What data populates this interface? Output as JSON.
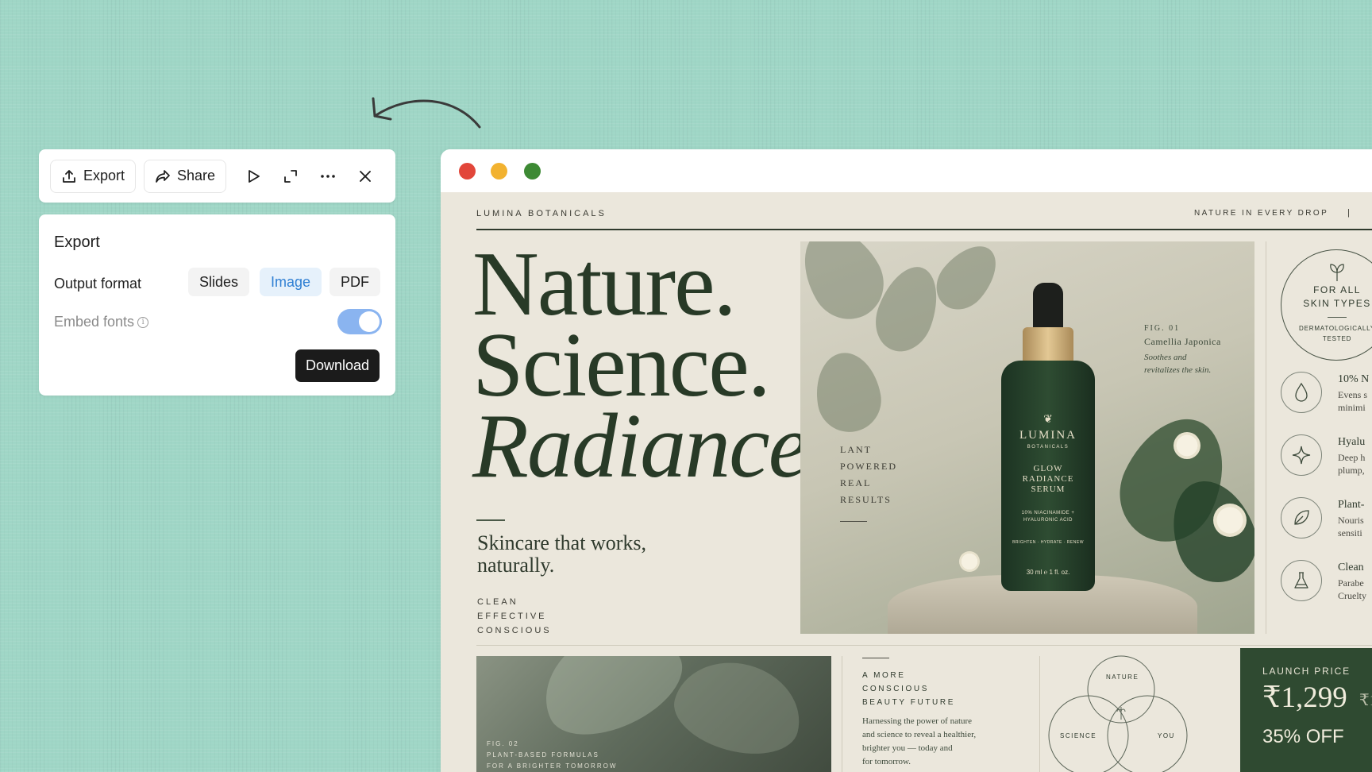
{
  "toolbar": {
    "export_label": "Export",
    "share_label": "Share",
    "icons": [
      "upload-icon",
      "share-icon",
      "play-icon",
      "expand-icon",
      "more-icon",
      "close-icon"
    ]
  },
  "export_panel": {
    "title": "Export",
    "output_format_label": "Output format",
    "formats": [
      "Slides",
      "Image",
      "PDF"
    ],
    "selected_format": "Image",
    "embed_fonts_label": "Embed fonts",
    "embed_fonts_enabled": true,
    "download_label": "Download"
  },
  "colors": {
    "background": "#9fd6c6",
    "accent": "#2f7fd3",
    "traffic_red": "#e2463a",
    "traffic_yellow": "#f2b230",
    "traffic_green": "#3d8a34",
    "poster_green": "#2f4a31"
  },
  "poster": {
    "brand": "LUMINA BOTANICALS",
    "tagline": "NATURE IN EVERY DROP",
    "tagline_separator": "|",
    "headline_1": "Nature.",
    "headline_2": "Science.",
    "headline_3": "Radiance.",
    "subheadline_1": "Skincare that works,",
    "subheadline_2": "naturally.",
    "attributes": [
      "CLEAN",
      "EFFECTIVE",
      "CONSCIOUS"
    ],
    "plant_claim": [
      "LANT",
      "POWERED",
      "REAL",
      "RESULTS"
    ],
    "fig1": {
      "label": "FIG. 01",
      "name": "Camellia Japonica",
      "desc_1": "Soothes and",
      "desc_2": "revitalizes the skin."
    },
    "bottle": {
      "brand": "LUMINA",
      "sub": "BOTANICALS",
      "product": "GLOW RADIANCE SERUM",
      "ingredients": "10% NIACINAMIDE + HYALURONIC ACID",
      "benefits": "BRIGHTEN · HYDRATE · RENEW",
      "volume": "30 ml ℮ 1 fl. oz."
    },
    "badge": {
      "title": "FOR ALL\nSKIN TYPES",
      "sub": "DERMATOLOGICALLY\nTESTED"
    },
    "features": [
      {
        "icon": "drop-icon",
        "title": "10% N",
        "line1": "Evens s",
        "line2": "minimi"
      },
      {
        "icon": "sparkle-icon",
        "title": "Hyalu",
        "line1": "Deep h",
        "line2": "plump,"
      },
      {
        "icon": "leaf-icon",
        "title": "Plant-",
        "line1": "Nouris",
        "line2": "sensiti"
      },
      {
        "icon": "flask-icon",
        "title": "Clean",
        "line1": "Parabe",
        "line2": "Cruelty"
      }
    ],
    "fig2": {
      "label": "FIG. 02",
      "line1": "PLANT-BASED FORMULAS",
      "line2": "FOR A BRIGHTER TOMORROW"
    },
    "future": {
      "heading": [
        "A MORE",
        "CONSCIOUS",
        "BEAUTY FUTURE"
      ],
      "body": [
        "Harnessing the power of nature",
        "and science to reveal a healthier,",
        "brighter you — today and",
        "for tomorrow."
      ]
    },
    "venn": {
      "top": "NATURE",
      "left": "SCIENCE",
      "right": "YOU"
    },
    "price": {
      "label": "LAUNCH PRICE",
      "value": "₹1,299",
      "old": "₹1",
      "discount": "35% OFF"
    }
  }
}
